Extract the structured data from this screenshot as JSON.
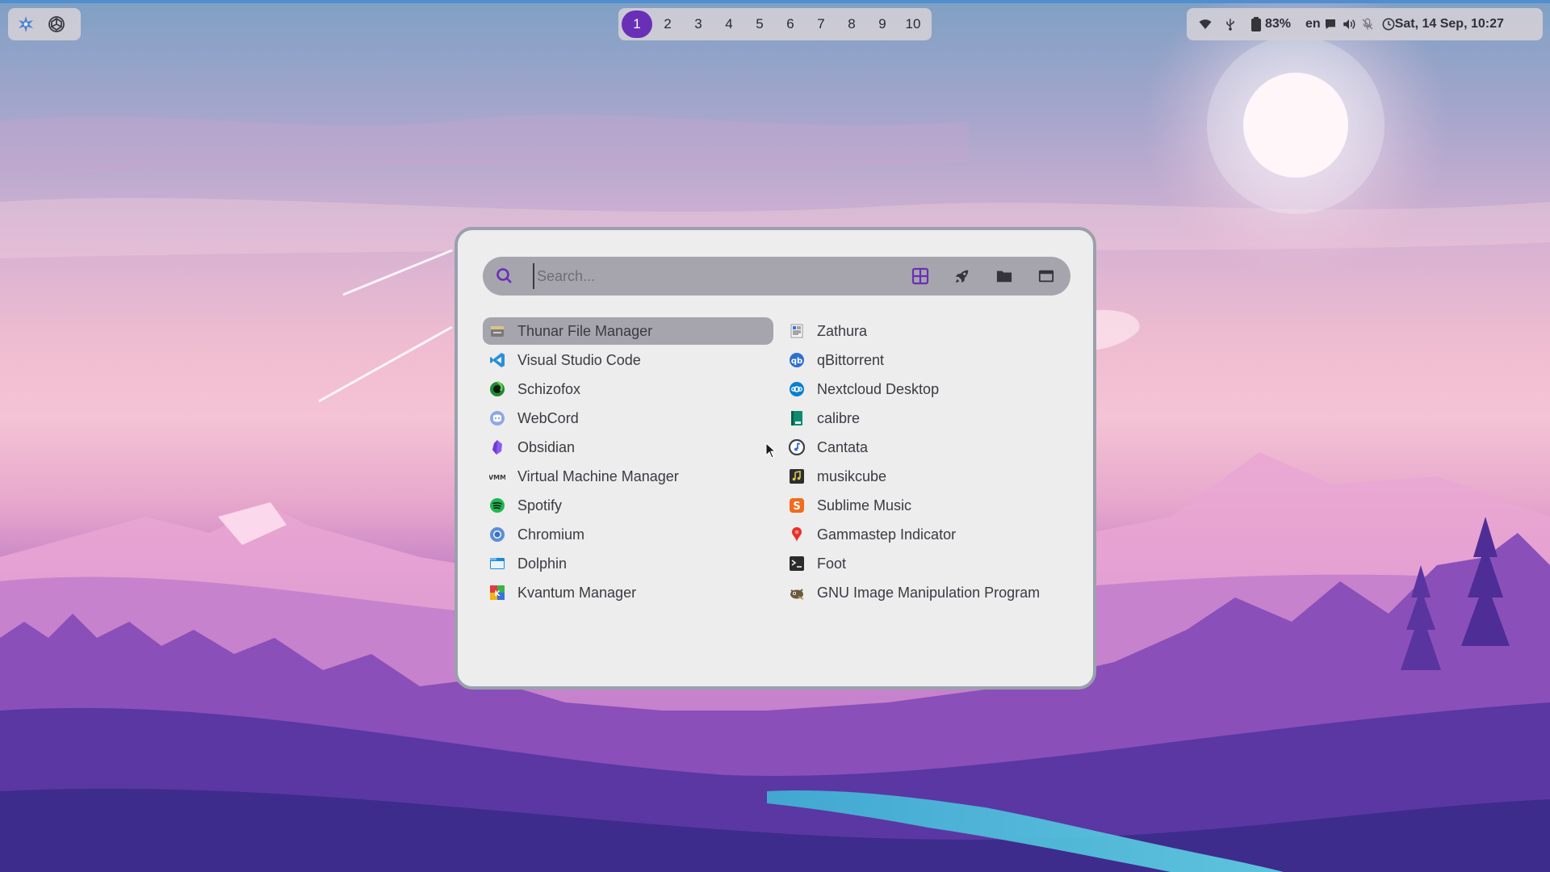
{
  "topbar": {
    "left_icons": [
      {
        "icon": "arch-star-icon"
      },
      {
        "icon": "openai-knot-icon"
      }
    ],
    "workspaces": [
      "1",
      "2",
      "3",
      "4",
      "5",
      "6",
      "7",
      "8",
      "9",
      "10"
    ],
    "active_workspace": "1",
    "tray": {
      "wifi_icon": "wifi-icon",
      "usb_icon": "usb-icon",
      "battery_icon": "battery-icon",
      "battery_percent": "83%",
      "keyboard_layout": "en",
      "chat_icon": "chat-icon",
      "volume_icon": "volume-icon",
      "mic_icon": "mic-muted-icon",
      "clock_icon": "clock-icon",
      "datetime": "Sat, 14 Sep, 10:27"
    }
  },
  "launcher": {
    "search": {
      "placeholder": "Search...",
      "value": ""
    },
    "modes": [
      {
        "icon": "grid-icon",
        "active": true
      },
      {
        "icon": "rocket-icon",
        "active": false
      },
      {
        "icon": "folder-icon",
        "active": false
      },
      {
        "icon": "window-icon",
        "active": false
      }
    ],
    "apps_left": [
      {
        "label": "Thunar File Manager",
        "icon": "thunar-icon",
        "selected": true
      },
      {
        "label": "Visual Studio Code",
        "icon": "vscode-icon"
      },
      {
        "label": "Schizofox",
        "icon": "schizofox-icon"
      },
      {
        "label": "WebCord",
        "icon": "webcord-icon"
      },
      {
        "label": "Obsidian",
        "icon": "obsidian-icon"
      },
      {
        "label": "Virtual Machine Manager",
        "icon": "virt-manager-icon"
      },
      {
        "label": "Spotify",
        "icon": "spotify-icon"
      },
      {
        "label": "Chromium",
        "icon": "chromium-icon"
      },
      {
        "label": "Dolphin",
        "icon": "dolphin-icon"
      },
      {
        "label": "Kvantum Manager",
        "icon": "kvantum-icon"
      }
    ],
    "apps_right": [
      {
        "label": "Zathura",
        "icon": "zathura-icon"
      },
      {
        "label": "qBittorrent",
        "icon": "qbittorrent-icon"
      },
      {
        "label": "Nextcloud Desktop",
        "icon": "nextcloud-icon"
      },
      {
        "label": "calibre",
        "icon": "calibre-icon"
      },
      {
        "label": "Cantata",
        "icon": "cantata-icon"
      },
      {
        "label": "musikcube",
        "icon": "musikcube-icon"
      },
      {
        "label": "Sublime Music",
        "icon": "sublime-music-icon"
      },
      {
        "label": "Gammastep Indicator",
        "icon": "gammastep-icon"
      },
      {
        "label": "Foot",
        "icon": "foot-terminal-icon"
      },
      {
        "label": "GNU Image Manipulation Program",
        "icon": "gimp-icon"
      }
    ]
  },
  "colors": {
    "accent": "#6a2fb7",
    "panel_bg": "#ededed",
    "selection": "#a6a5ad",
    "bar_bg": "#d0ced6"
  }
}
